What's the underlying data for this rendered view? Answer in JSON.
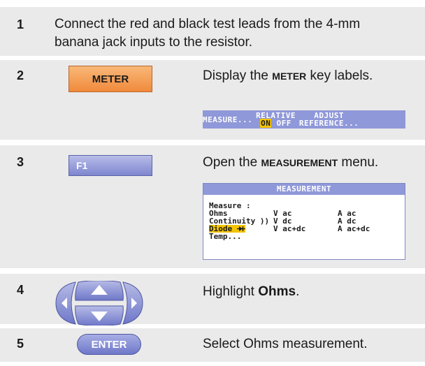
{
  "steps": [
    {
      "number": "1",
      "text": "Connect the red and black test leads from the 4-mm banana jack inputs to the resistor."
    },
    {
      "number": "2",
      "key": "METER",
      "text_pre": "Display the ",
      "text_kw": "METER",
      "text_post": " key labels.",
      "softkeys": {
        "k1": "MEASURE...",
        "k2_top": "RELATIVE",
        "k2_on": "ON",
        "k2_off": "OFF",
        "k3_top": "ADJUST",
        "k3_bottom": "REFERENCE..."
      }
    },
    {
      "number": "3",
      "key": "F1",
      "text_pre": "Open the ",
      "text_kw": "MEASUREMENT",
      "text_post": " menu.",
      "menu": {
        "title": "MEASUREMENT",
        "heading": "Measure :",
        "rows": [
          [
            "Ohms",
            "V ac",
            "A ac"
          ],
          [
            "Continuity ))",
            "V dc",
            "A dc"
          ],
          [
            "Diode",
            "V ac+dc",
            "A ac+dc"
          ],
          [
            "Temp...",
            "",
            ""
          ]
        ]
      }
    },
    {
      "number": "4",
      "text_pre": "Highlight ",
      "text_kw": "Ohms",
      "text_post": "."
    },
    {
      "number": "5",
      "key": "ENTER",
      "text": "Select Ohms measurement."
    }
  ],
  "colors": {
    "row_bg": "#eaeaea",
    "meter_key": "#f08a3c",
    "display_blue": "#8f98d8",
    "highlight_yellow": "#f2c400"
  }
}
